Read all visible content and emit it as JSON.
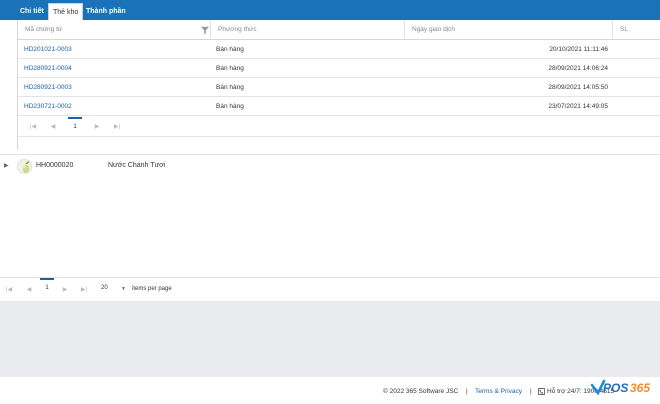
{
  "tabs": [
    {
      "label": "Chi tiết",
      "active": false
    },
    {
      "label": "Thẻ kho",
      "active": true
    },
    {
      "label": "Thành phần",
      "active": false
    }
  ],
  "grid": {
    "columns": [
      "Mã chứng từ",
      "Phương thức",
      "Ngày giao dịch",
      "SL"
    ],
    "rows": [
      {
        "code": "HD201021-0003",
        "method": "Bán hàng",
        "date": "20/10/2021 11:11:46"
      },
      {
        "code": "HD280921-0004",
        "method": "Bán hàng",
        "date": "28/09/2021 14:06:24"
      },
      {
        "code": "HD280921-0003",
        "method": "Bán hàng",
        "date": "28/09/2021 14:05:50"
      },
      {
        "code": "HD230721-0002",
        "method": "Bán hàng",
        "date": "23/07/2021 14:49:05"
      }
    ],
    "pager": {
      "page": "1"
    }
  },
  "product": {
    "code": "HH0000020",
    "name": "Nước Chanh Tươi"
  },
  "main_pager": {
    "page": "1",
    "page_size": "20",
    "items_per_page_label": "items per page"
  },
  "footer": {
    "copyright": "© 2022 365 Software JSC",
    "sep1": "|",
    "terms": "Terms & Privacy",
    "sep2": "|",
    "support": "Hỗ trợ 24/7: 1900 4515",
    "logo_text": "POS365"
  },
  "colors": {
    "brand_blue": "#1a73b8",
    "link_blue": "#1a5fa8",
    "band_grey": "#e9ebee"
  }
}
